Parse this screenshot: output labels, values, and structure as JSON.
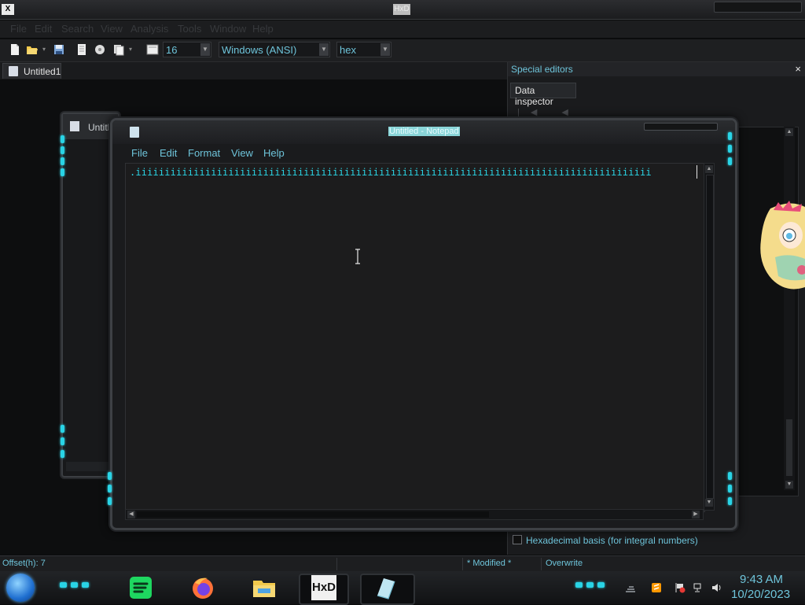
{
  "hxd": {
    "app_icon_label": "X",
    "window_title": "HxD",
    "menu": [
      "File",
      "Edit",
      "Search",
      "View",
      "Analysis",
      "Tools",
      "Window",
      "Help"
    ],
    "toolbar": {
      "bytes_per_row": "16",
      "charset": "Windows (ANSI)",
      "offset_base": "hex"
    },
    "document_tab": "Untitled1"
  },
  "special_editors": {
    "title": "Special editors",
    "close": "×",
    "tab": "Data inspector",
    "nav_arrows": "|◀ ◀ ▶ ▶|",
    "hex_basis_label": "Hexadecimal basis (for integral numbers)"
  },
  "hxd_window2": {
    "tab_label": "Untitle"
  },
  "notepad": {
    "title": "Untitled - Notepad",
    "menu": [
      "File",
      "Edit",
      "Format",
      "View",
      "Help"
    ],
    "text": ".iiiiiiiiiiiiiiiiiiiiiiiiiiiiiiiiiiiiiiiiiiiiiiiiiiiiiiiiiiiiiiiiiiiiiiiiiiiiiiiiiiiiiiiii"
  },
  "status": {
    "offset": "Offset(h): 7",
    "modified": "* Modified *",
    "mode": "Overwrite"
  },
  "taskbar": {
    "time": "9:43 AM",
    "date": "10/20/2023",
    "hxd_button_label": "HxD",
    "apps": [
      "spotify-icon",
      "firefox-icon",
      "file-explorer-icon",
      "hxd-icon",
      "notepad-icon"
    ]
  },
  "colors": {
    "accent_cyan": "#29d4e6",
    "text_cyan": "#6ec4da",
    "background": "#0b0c0d"
  }
}
